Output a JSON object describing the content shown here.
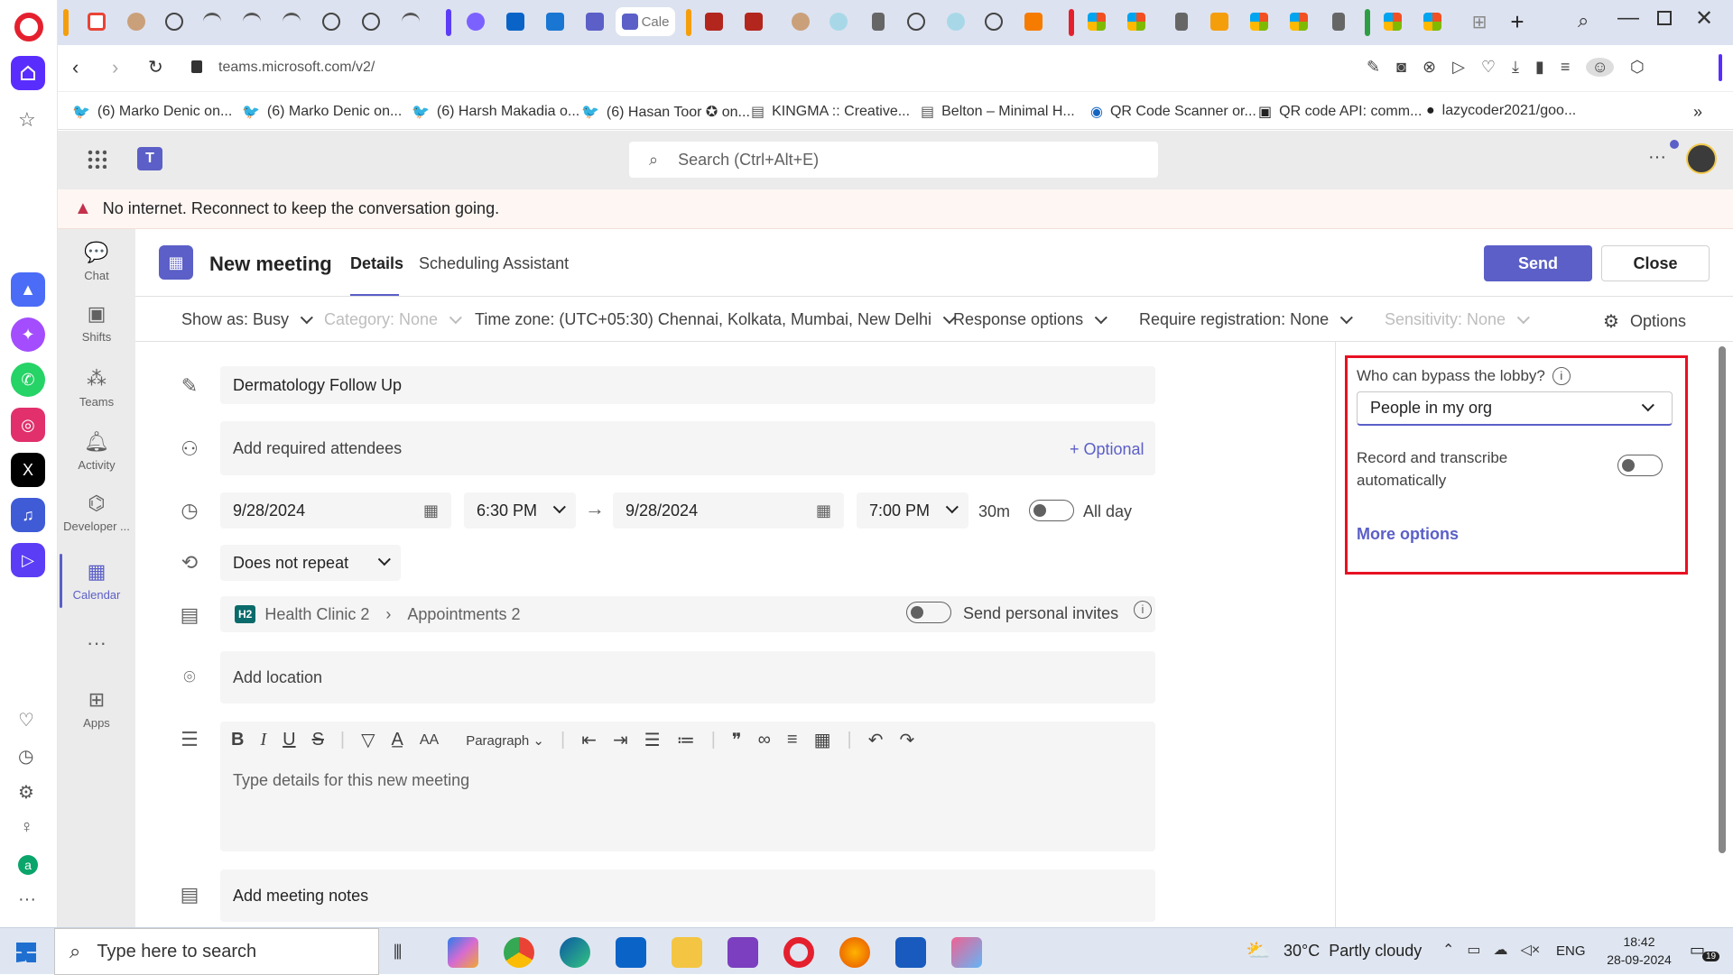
{
  "browser": {
    "url": "teams.microsoft.com/v2/",
    "active_tab_label": "Cale",
    "bookmarks": [
      "(6) Marko Denic on...",
      "(6) Marko Denic on...",
      "(6) Harsh Makadia o...",
      "(6) Hasan Toor ✪ on...",
      "KINGMA :: Creative...",
      "Belton – Minimal H...",
      "QR Code Scanner or...",
      "QR code API: comm...",
      "lazycoder2021/goo..."
    ]
  },
  "teams": {
    "search_placeholder": "Search (Ctrl+Alt+E)",
    "banner": "No internet. Reconnect to keep the conversation going.",
    "nav": [
      "Chat",
      "Shifts",
      "Teams",
      "Activity",
      "Developer ...",
      "Calendar",
      "Apps"
    ],
    "nav_active": "Calendar"
  },
  "meeting": {
    "title": "New meeting",
    "tabs": [
      "Details",
      "Scheduling Assistant"
    ],
    "active_tab": "Details",
    "send_label": "Send",
    "close_label": "Close",
    "props": {
      "show_as": "Show as: Busy",
      "category": "Category: None",
      "time_zone": "Time zone: (UTC+05:30) Chennai, Kolkata, Mumbai, New Delhi",
      "response": "Response options",
      "registration": "Require registration: None",
      "sensitivity": "Sensitivity: None",
      "options": "Options"
    },
    "subject": "Dermatology Follow Up",
    "attendees_placeholder": "Add required attendees",
    "optional_label": "+ Optional",
    "start_date": "9/28/2024",
    "start_time": "6:30 PM",
    "end_date": "9/28/2024",
    "end_time": "7:00 PM",
    "duration": "30m",
    "all_day_label": "All day",
    "repeat": "Does not repeat",
    "channel_badge": "H2",
    "team": "Health Clinic 2",
    "channel": "Appointments 2",
    "send_invites_label": "Send personal invites",
    "location_placeholder": "Add location",
    "paragraph_label": "Paragraph",
    "details_placeholder": "Type details for this new meeting",
    "notes_placeholder": "Add meeting notes"
  },
  "options_panel": {
    "lobby_label": "Who can bypass the lobby?",
    "lobby_value": "People in my org",
    "record_label_1": "Record and transcribe",
    "record_label_2": "automatically",
    "more_options": "More options",
    "highlight_color": "#e81123"
  },
  "taskbar": {
    "search_placeholder": "Type here to search",
    "weather": "30°C  Partly cloudy",
    "lang": "ENG",
    "time": "18:42",
    "date": "28-09-2024",
    "notifications": "19"
  },
  "colors": {
    "teams_purple": "#5b5fc7",
    "banner_warning": "#c4314b"
  }
}
